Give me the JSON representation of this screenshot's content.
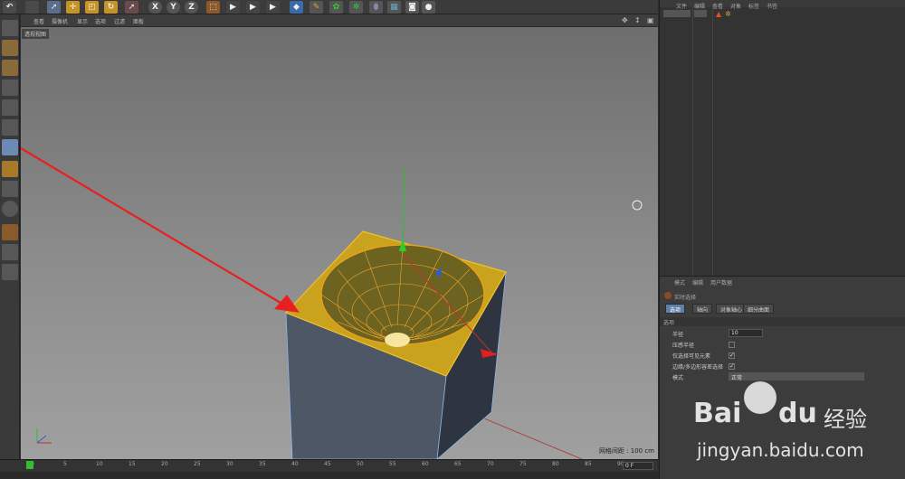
{
  "viewport": {
    "menu": [
      "查看",
      "摄像机",
      "显示",
      "选项",
      "过滤",
      "面板"
    ],
    "label": "透视视图",
    "grid_readout": "网格间距 : 100 cm"
  },
  "object_manager": {
    "menu": [
      "文件",
      "编辑",
      "查看",
      "对象",
      "标签",
      "书签"
    ]
  },
  "attributes": {
    "menu": [
      "模式",
      "编辑",
      "用户数据"
    ],
    "title": "实时选择",
    "tabs": [
      "选项",
      "轴向",
      "对象轴心",
      "细分曲面"
    ],
    "section": "选项",
    "radius_label": "半径",
    "radius_value": "10",
    "pressure_label": "压感半径",
    "visible_label": "仅选择可见元素",
    "edge_label": "边缘/多边形容差选择",
    "mode_label": "模式",
    "mode_value": "正常"
  },
  "timeline": {
    "ticks": [
      "0",
      "5",
      "10",
      "15",
      "20",
      "25",
      "30",
      "35",
      "40",
      "45",
      "50",
      "55",
      "60",
      "65",
      "70",
      "75",
      "80",
      "85",
      "90"
    ],
    "frame_value": "0 F"
  },
  "watermark": {
    "brand_a": "Bai",
    "brand_b": "du",
    "brand_cn": "经验",
    "url": "jingyan.baidu.com"
  }
}
